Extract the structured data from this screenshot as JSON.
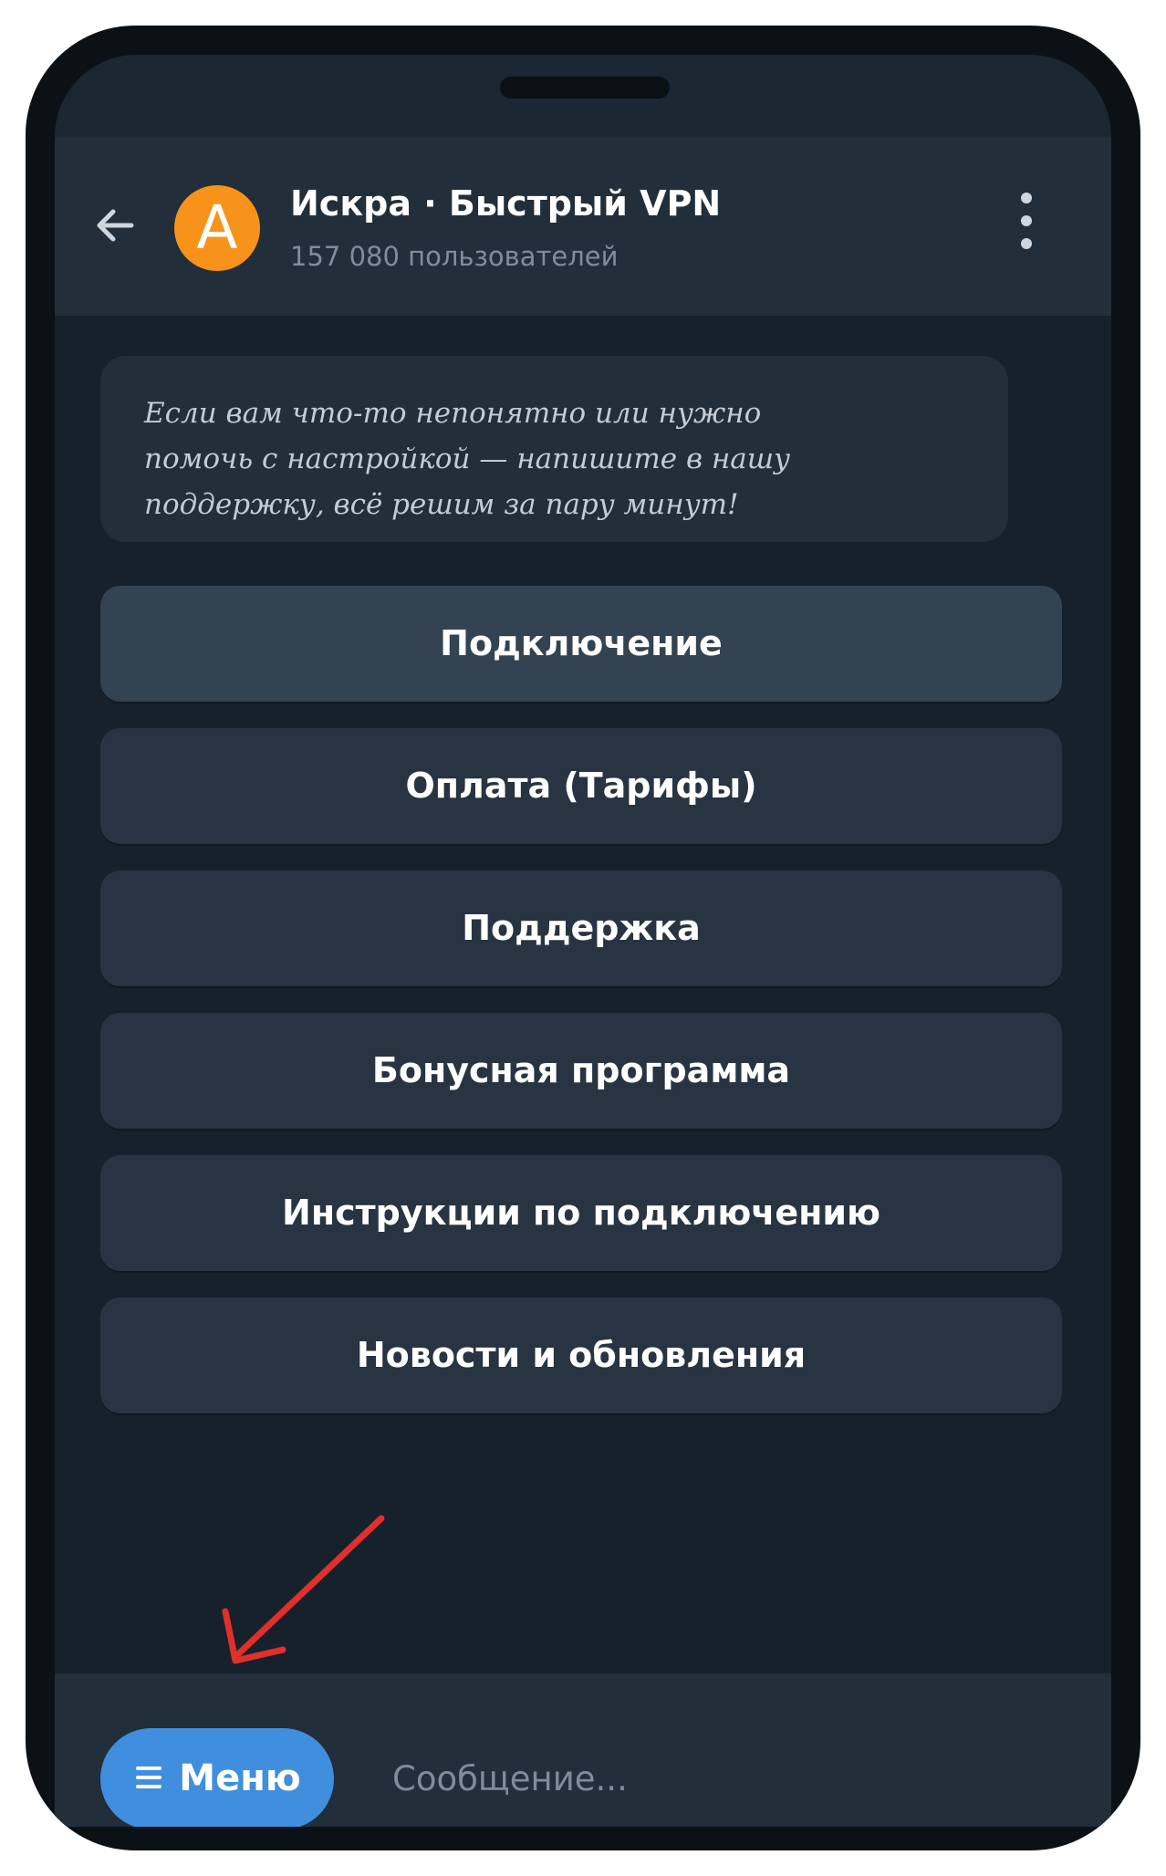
{
  "header": {
    "avatar_letter": "A",
    "title": "Искра · Быстрый VPN",
    "subtitle": "157 080 пользователей",
    "avatar_color": "#f7931a"
  },
  "message": {
    "text": "Если вам что-то непонятно или нужно\nпомочь с настройкой — напишите в нашу\nподдержку, всё решим за пару минут!"
  },
  "keyboard": {
    "buttons": [
      {
        "label": "Подключение"
      },
      {
        "label": "Оплата (Тарифы)"
      },
      {
        "label": "Поддержка"
      },
      {
        "label": "Бонусная программа"
      },
      {
        "label": "Инструкции по подключению"
      },
      {
        "label": "Новости и обновления"
      }
    ]
  },
  "bottom_bar": {
    "menu_label": "Меню",
    "input_placeholder": "Сообщение..."
  },
  "colors": {
    "background": "#17212b",
    "header": "#222e3a",
    "button": "#283441",
    "accent": "#3f8fde",
    "annotation": "#d9302c"
  },
  "icons": {
    "back": "arrow-left-icon",
    "more": "more-vertical-icon",
    "menu": "hamburger-icon"
  }
}
